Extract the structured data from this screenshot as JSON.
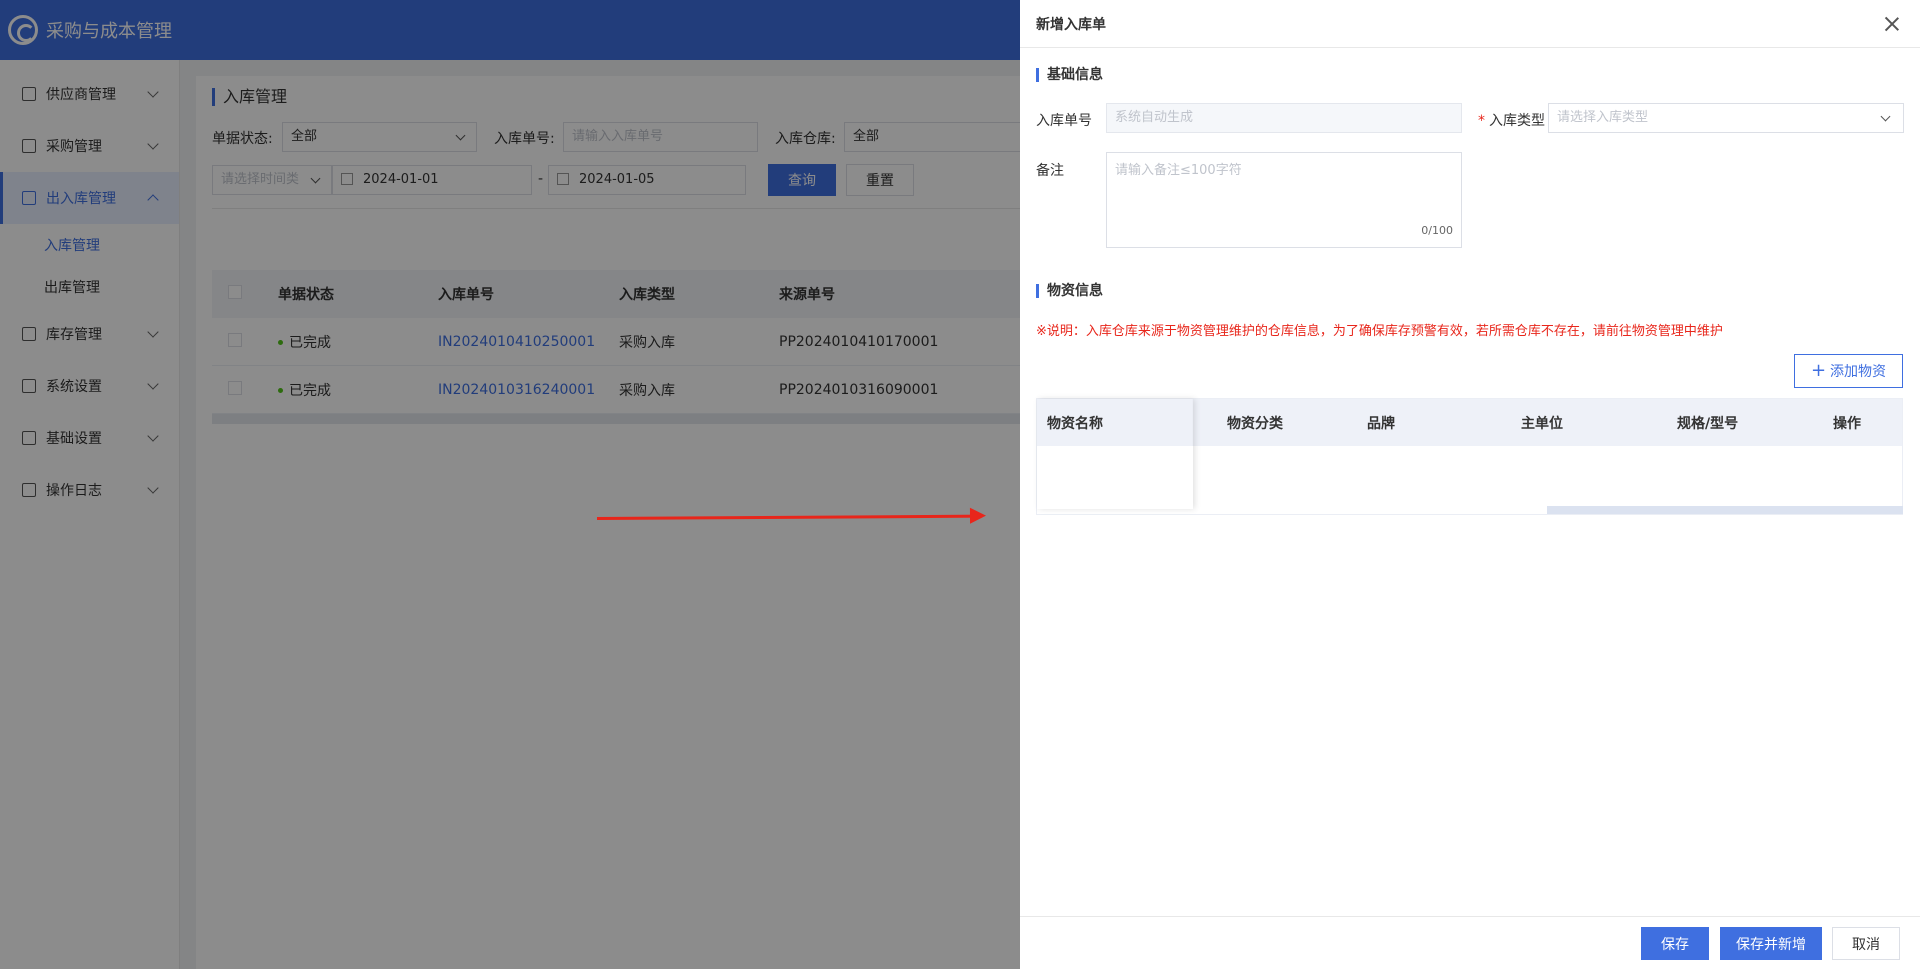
{
  "app": {
    "title": "采购与成本管理"
  },
  "sidebar": {
    "items": [
      {
        "label": "供应商管理",
        "icon": "supplier-icon"
      },
      {
        "label": "采购管理",
        "icon": "purchase-icon"
      },
      {
        "label": "出入库管理",
        "icon": "inout-icon",
        "active": true
      },
      {
        "label": "库存管理",
        "icon": "inventory-icon"
      },
      {
        "label": "系统设置",
        "icon": "settings-icon"
      },
      {
        "label": "基础设置",
        "icon": "gear-icon"
      },
      {
        "label": "操作日志",
        "icon": "log-icon"
      }
    ],
    "subitems": [
      {
        "label": "入库管理",
        "active": true
      },
      {
        "label": "出库管理"
      }
    ]
  },
  "main": {
    "title": "入库管理",
    "filters": {
      "status_label": "单据状态:",
      "status_value": "全部",
      "no_label": "入库单号:",
      "no_placeholder": "请输入入库单号",
      "warehouse_label": "入库仓库:",
      "warehouse_value": "全部",
      "time_type_placeholder": "请选择时间类",
      "date_start": "2024-01-01",
      "date_sep": "-",
      "date_end": "2024-01-05",
      "query_label": "查询",
      "reset_label": "重置"
    },
    "table": {
      "headers": [
        "单据状态",
        "入库单号",
        "入库类型",
        "来源单号"
      ],
      "rows": [
        {
          "status": "已完成",
          "no": "IN2024010410250001",
          "type": "采购入库",
          "source": "PP2024010410170001"
        },
        {
          "status": "已完成",
          "no": "IN2024010316240001",
          "type": "采购入库",
          "source": "PP2024010316090001"
        }
      ]
    }
  },
  "drawer": {
    "title": "新增入库单",
    "basic_section": "基础信息",
    "fields": {
      "no_label": "入库单号",
      "no_placeholder": "系统自动生成",
      "type_required": "*",
      "type_label": "入库类型",
      "type_placeholder": "请选择入库类型",
      "remark_label": "备注",
      "remark_placeholder": "请输入备注≤100字符",
      "remark_counter": "0/100"
    },
    "material_section": "物资信息",
    "note": "※说明：入库仓库来源于物资管理维护的仓库信息，为了确保库存预警有效，若所需仓库不存在，请前往物资管理中维护",
    "add_material": "添加物资",
    "material_headers": [
      "物资名称",
      "物资分类",
      "品牌",
      "主单位",
      "规格/型号",
      "操作"
    ],
    "footer": {
      "save": "保存",
      "save_new": "保存并新增",
      "cancel": "取消"
    }
  },
  "colors": {
    "primary": "#3f6fe0",
    "danger": "#e8261b",
    "success": "#52c41a"
  }
}
